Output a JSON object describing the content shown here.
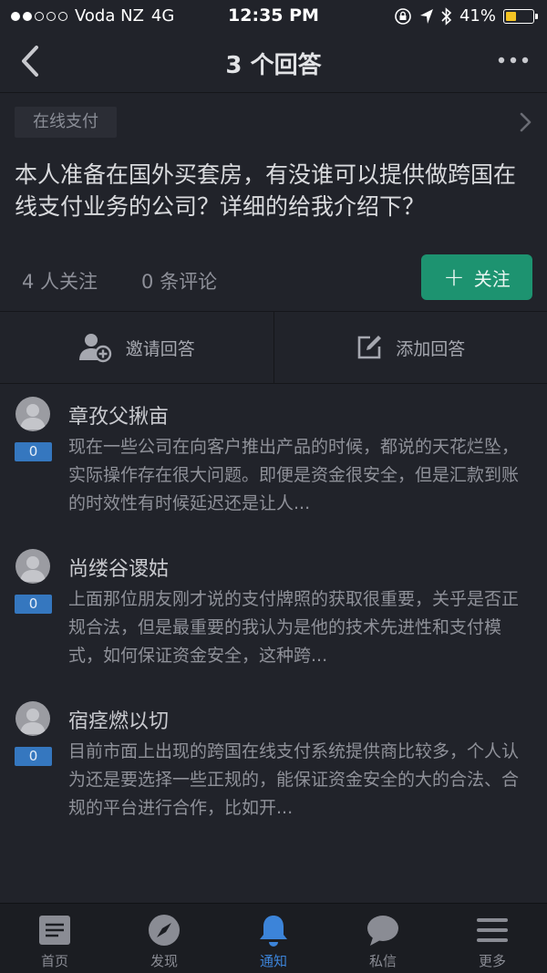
{
  "status_bar": {
    "carrier": "Voda NZ",
    "network": "4G",
    "time": "12:35 PM",
    "battery": "41%",
    "battery_level": 0.41,
    "battery_color": "#f3c324"
  },
  "nav": {
    "title": "3 个回答"
  },
  "topic": {
    "tag": "在线支付"
  },
  "question": {
    "text": "本人准备在国外买套房，有没谁可以提供做跨国在线支付业务的公司？详细的给我介绍下？"
  },
  "stats": {
    "followers": "4 人关注",
    "comments": "0 条评论"
  },
  "follow_button": {
    "label": "关注",
    "color": "#1d9370"
  },
  "actions": {
    "invite": "邀请回答",
    "add_answer": "添加回答"
  },
  "answers": [
    {
      "author": "章孜父揪亩",
      "votes": "0",
      "excerpt": "现在一些公司在向客户推出产品的时候，都说的天花烂坠，实际操作存在很大问题。即便是资金很安全，但是汇款到账的时效性有时候延迟还是让人..."
    },
    {
      "author": "尚缕谷谡姑",
      "votes": "0",
      "excerpt": "上面那位朋友刚才说的支付牌照的获取很重要，关乎是否正规合法，但是最重要的我认为是他的技术先进性和支付模式，如何保证资金安全，这种跨..."
    },
    {
      "author": "宿痉燃以切",
      "votes": "0",
      "excerpt": "目前市面上出现的跨国在线支付系统提供商比较多，个人认为还是要选择一些正规的，能保证资金安全的大的合法、合规的平台进行合作，比如开..."
    }
  ],
  "tabs": [
    {
      "label": "首页",
      "icon": "home-icon"
    },
    {
      "label": "发现",
      "icon": "compass-icon"
    },
    {
      "label": "通知",
      "icon": "bell-icon",
      "active": true
    },
    {
      "label": "私信",
      "icon": "chat-bubble-icon"
    },
    {
      "label": "更多",
      "icon": "menu-icon"
    }
  ],
  "accent_color": "#3c84d9"
}
